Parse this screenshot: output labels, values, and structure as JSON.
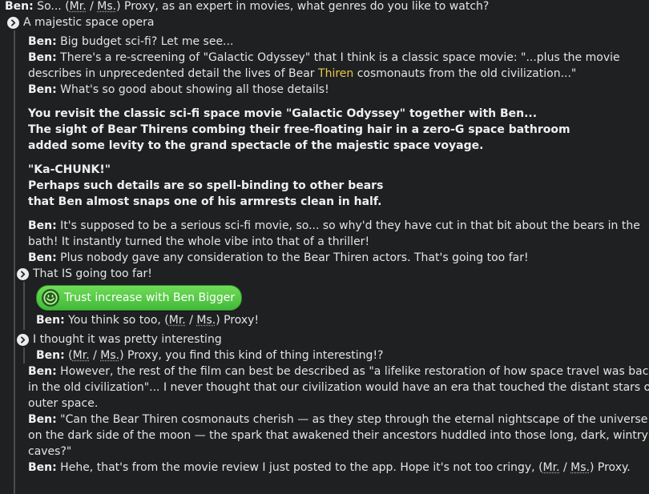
{
  "intro": {
    "speaker": "Ben:",
    "pre": " So... (",
    "mr": "Mr.",
    "slash": " / ",
    "ms": "Ms.",
    "post": ") Proxy, as an expert in movies, what genres do you like to watch?"
  },
  "choice_space_opera": "A majestic space opera",
  "branch1": {
    "l1_speaker": "Ben:",
    "l1_text": " Big budget sci-fi? Let me see...",
    "l2_speaker": "Ben:",
    "l2_pre": " There's a re-screening of \"Galactic Odyssey\" that I think is a classic space movie: \"...plus the movie",
    "l2_cont_pre": "describes in unprecedented detail the lives of Bear ",
    "l2_highlight": "Thiren",
    "l2_cont_post": " cosmonauts from the old civilization...\"",
    "l3_speaker": "Ben:",
    "l3_text": " What's so good about showing all those details!",
    "narr1": [
      "You revisit the classic sci-fi space movie \"Galactic Odyssey\" together with Ben...",
      "The sight of Bear Thirens combing their free-floating hair in a zero-G space bathroom",
      "added some levity to the grand spectacle of the majestic space voyage."
    ],
    "narr2": [
      "\"Ka-CHUNK!\"",
      "Perhaps such details are so spell-binding to other bears",
      "that Ben almost snaps one of his armrests clean in half."
    ],
    "l4_speaker": "Ben:",
    "l4_text_a": " It's supposed to be a serious sci-fi movie, so... so why'd they have cut in that bit about the bears in the",
    "l4_text_b": "bath! It instantly turned the whole vibe into that of a thriller!",
    "l5_speaker": "Ben:",
    "l5_text": " Plus nobody gave any consideration to the Bear Thiren actors. That's going too far!"
  },
  "choice_too_far": "That IS going too far!",
  "trust_button": "Trust increase with Ben Bigger",
  "reply_too_far": {
    "speaker": "Ben:",
    "pre": " You think so too, (",
    "mr": "Mr.",
    "slash": " / ",
    "ms": "Ms.",
    "post": ") Proxy!"
  },
  "choice_interesting": "I thought it was pretty interesting",
  "reply_interesting": {
    "speaker": "Ben:",
    "pre": " (",
    "mr": "Mr.",
    "slash": " / ",
    "ms": "Ms.",
    "post": ") Proxy, you find this kind of thing interesting!?"
  },
  "tail": {
    "l1_speaker": "Ben:",
    "l1_a": " However, the rest of the film can best be described as \"a lifelike restoration of how space travel was back",
    "l1_b": "in the old civilization\"... I never thought that our civilization would have an era that touched the distant stars of",
    "l1_c": "outer space.",
    "l2_speaker": "Ben:",
    "l2_a": " \"Can the Bear Thiren cosmonauts cherish — as they step through the eternal nightscape of the universe",
    "l2_b": "on the dark side of the moon — the spark that awakened their ancestors huddled into those long, dark, wintry",
    "l2_c": "caves?\"",
    "l3_speaker": "Ben:",
    "l3_pre": " Hehe, that's from the movie review I just posted to the app. Hope it's not too cringy, (",
    "l3_mr": "Mr.",
    "l3_slash": " / ",
    "l3_ms": "Ms.",
    "l3_post": ") Proxy."
  },
  "colors": {
    "background": "#1f2022",
    "text": "#e4e4e4",
    "highlight": "#e8c84a",
    "trust_green": "#4fc443"
  },
  "icons": {
    "choice": "chevron-right-circle-icon",
    "trust": "smile-icon"
  }
}
